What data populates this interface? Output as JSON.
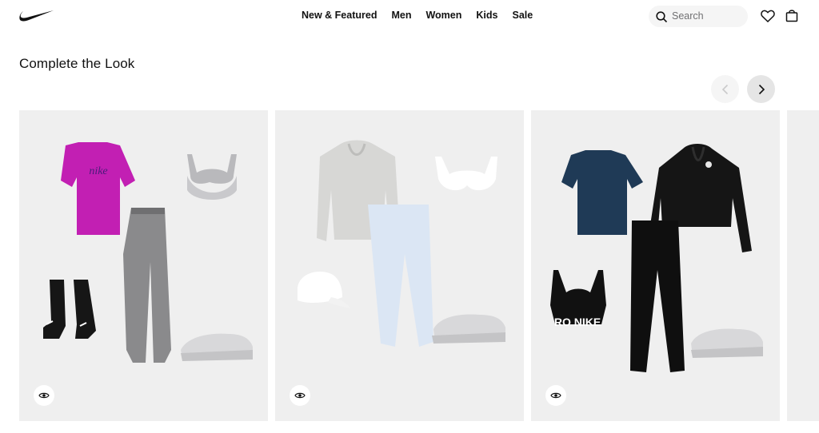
{
  "nav": {
    "links": [
      "New & Featured",
      "Men",
      "Women",
      "Kids",
      "Sale"
    ],
    "search_placeholder": "Search"
  },
  "section": {
    "title": "Complete the Look"
  },
  "cards": [
    {
      "print_text": "nike"
    },
    {
      "print_text": ""
    },
    {
      "print_text": "RO NIKE"
    }
  ],
  "icons": {
    "logo": "swoosh-icon",
    "search": "search-icon",
    "favorites": "heart-icon",
    "bag": "bag-icon",
    "prev": "chevron-left-icon",
    "next": "chevron-right-icon",
    "view": "eye-icon"
  }
}
